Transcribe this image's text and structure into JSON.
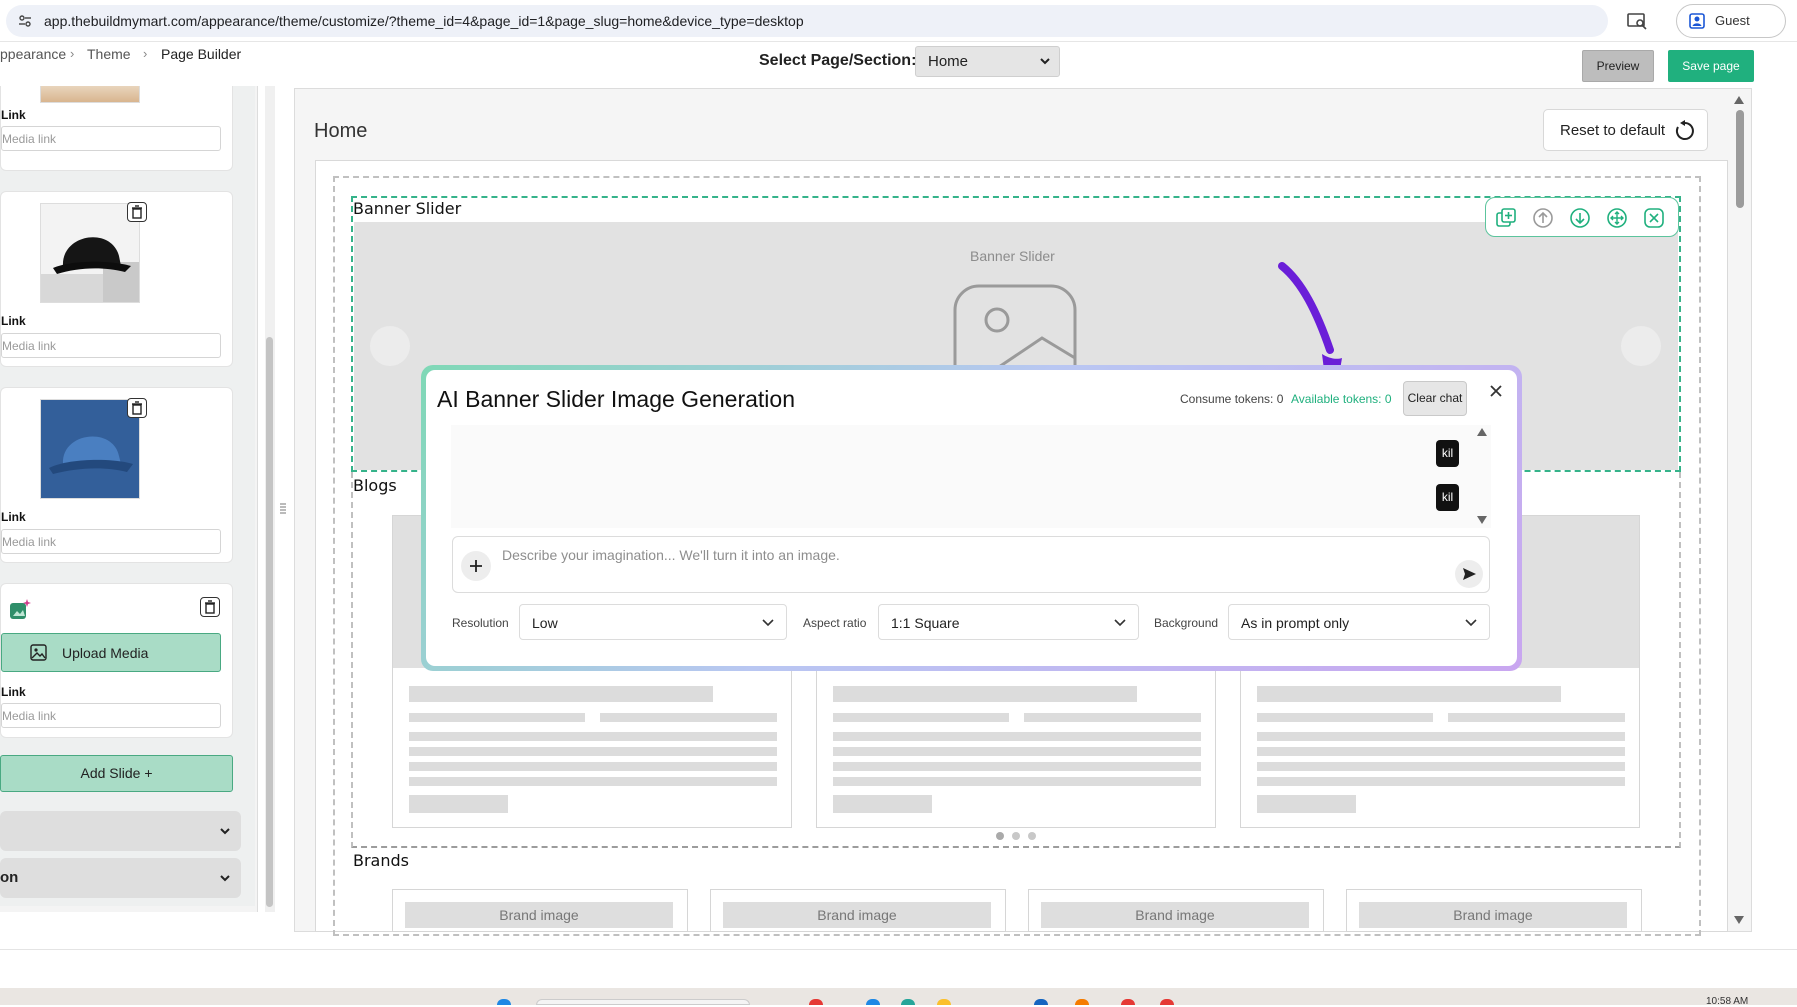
{
  "browser": {
    "url": "app.thebuildmymart.com/appearance/theme/customize/?theme_id=4&page_id=1&page_slug=home&device_type=desktop",
    "profile_label": "Guest"
  },
  "breadcrumb": {
    "items": [
      "ppearance",
      "Theme",
      "Page Builder"
    ]
  },
  "header": {
    "select_label": "Select Page/Section:",
    "selected_page": "Home",
    "preview_label": "Preview",
    "save_label": "Save page"
  },
  "sidebar": {
    "link_label": "Link",
    "media_placeholder": "Media link",
    "upload_label": "Upload Media",
    "add_slide_label": "Add Slide +",
    "accordion_partial_label": "on"
  },
  "main": {
    "title": "Home",
    "reset_label": "Reset to default",
    "sections": {
      "banner": "Banner Slider",
      "banner_placeholder": "Banner Slider",
      "blogs": "Blogs",
      "brands": "Brands"
    },
    "brand_label": "Brand image"
  },
  "modal": {
    "title": "AI Banner Slider Image Generation",
    "consume_tokens": "Consume tokens: 0",
    "available_tokens": "Available tokens: 0",
    "clear_chat_label": "Clear chat",
    "chat_messages": [
      "kil",
      "kil"
    ],
    "prompt_placeholder": "Describe your imagination... We'll turn it into an image.",
    "options": {
      "resolution": {
        "label": "Resolution",
        "value": "Low"
      },
      "aspect_ratio": {
        "label": "Aspect ratio",
        "value": "1:1 Square"
      },
      "background": {
        "label": "Background",
        "value": "As in prompt only"
      }
    }
  },
  "colors": {
    "accent_green": "#20b07e",
    "dashed_green": "#35b38a",
    "annotation_purple": "#6a1ed8"
  },
  "taskbar": {
    "clock": "10:58 AM"
  }
}
